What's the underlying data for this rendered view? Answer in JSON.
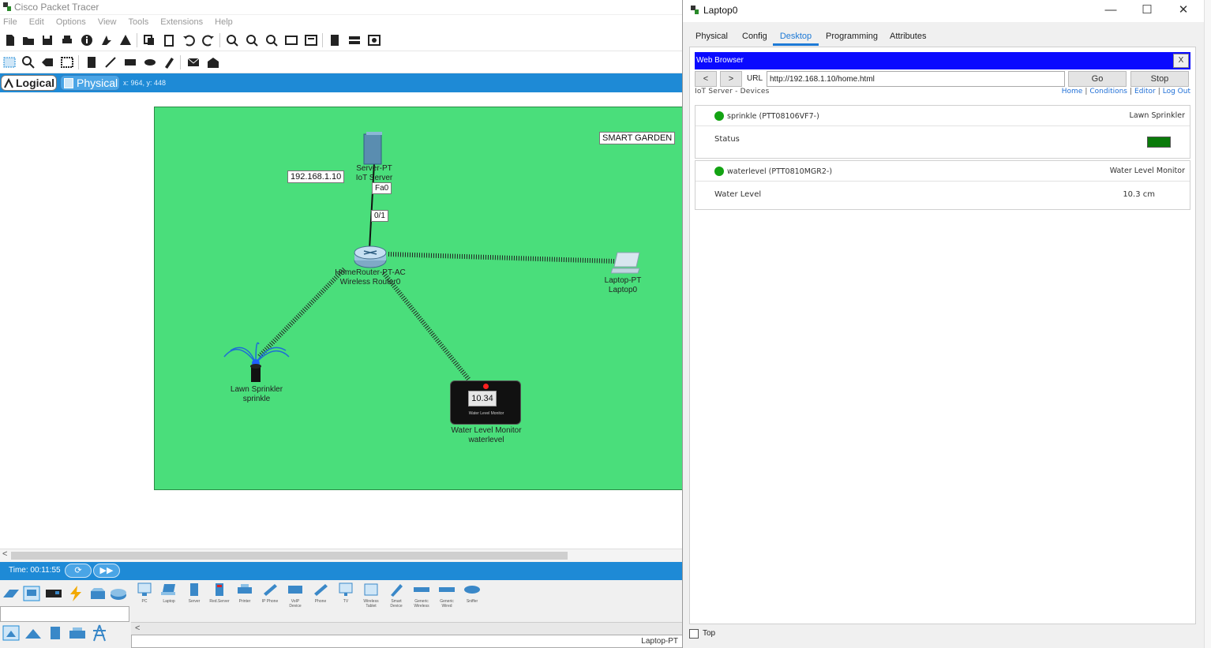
{
  "app": {
    "title": "Cisco Packet Tracer",
    "menu": [
      "File",
      "Edit",
      "Options",
      "View",
      "Tools",
      "Extensions",
      "Help"
    ]
  },
  "mode_bar": {
    "logical_label": "Logical",
    "physical_label": "Physical",
    "coords": "x: 964, y: 448"
  },
  "workspace": {
    "cluster_title": "SMART GARDEN",
    "cluster_color": "#4ade7b",
    "ip_label": "192.168.1.10",
    "port_fa0": "Fa0",
    "port_01": "0/1",
    "server": {
      "model": "Server-PT",
      "name": "IoT Server"
    },
    "router": {
      "model": "HomeRouter-PT-AC",
      "name": "Wireless Router0"
    },
    "laptop": {
      "model": "Laptop-PT",
      "name": "Laptop0"
    },
    "sprinkler": {
      "model": "Lawn Sprinkler",
      "name": "sprinkle"
    },
    "water_monitor": {
      "model": "Water Level Monitor",
      "name": "waterlevel",
      "display": "10.34",
      "caption": "Water Level Monitor"
    }
  },
  "time_bar": {
    "time": "Time: 00:11:55"
  },
  "device_palette": [
    "PC",
    "Laptop",
    "Server",
    "Red.Server",
    "Printer",
    "IP Phone",
    "VoIP Device",
    "Phone",
    "TV",
    "Wireless Tablet",
    "Smart Device",
    "Generic Wireless",
    "Generic Wired",
    "Sniffer"
  ],
  "status_strip": "Laptop-PT",
  "laptop_window": {
    "title": "Laptop0",
    "tabs": [
      "Physical",
      "Config",
      "Desktop",
      "Programming",
      "Attributes"
    ],
    "active_tab": "Desktop",
    "browser": {
      "title": "Web Browser",
      "close": "X",
      "back": "<",
      "forward": ">",
      "url_label": "URL",
      "url": "http://192.168.1.10/home.html",
      "go": "Go",
      "stop": "Stop"
    },
    "iot": {
      "title": "IoT Server - Devices",
      "links": [
        "Home",
        "Conditions",
        "Editor",
        "Log Out"
      ],
      "devices": [
        {
          "name": "sprinkle (PTT08106VF7-)",
          "type": "Lawn Sprinkler",
          "prop": "Status",
          "status_color": "#0a7a0a"
        },
        {
          "name": "waterlevel (PTT0810MGR2-)",
          "type": "Water Level Monitor",
          "prop": "Water Level",
          "value": "10.3 cm"
        }
      ]
    },
    "top_label": "Top"
  }
}
